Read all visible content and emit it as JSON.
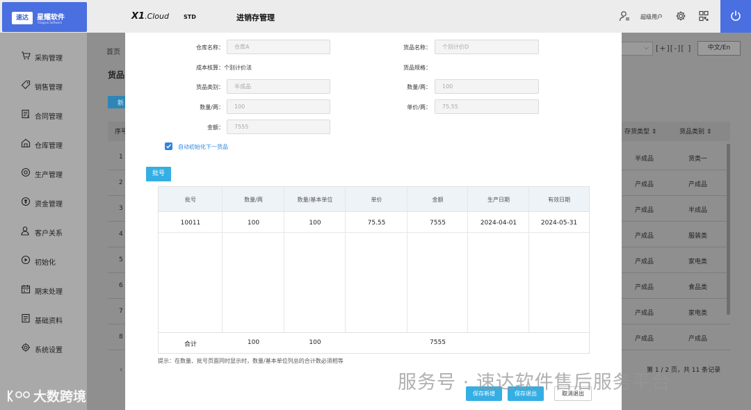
{
  "header": {
    "logo_badge": "速达",
    "logo_name": "星耀软件",
    "logo_sub": "Xingyao Software",
    "brand_main": "X1",
    "brand_suffix": ".Cloud",
    "edition": "STD",
    "module_title": "进销存管理",
    "user_label": "超级用户"
  },
  "sidebar": {
    "items": [
      {
        "label": "采购管理",
        "icon": "cart-icon"
      },
      {
        "label": "销售管理",
        "icon": "tag-icon"
      },
      {
        "label": "合同管理",
        "icon": "contract-icon"
      },
      {
        "label": "仓库管理",
        "icon": "warehouse-icon"
      },
      {
        "label": "生产管理",
        "icon": "production-icon"
      },
      {
        "label": "资金管理",
        "icon": "money-icon"
      },
      {
        "label": "客户关系",
        "icon": "customer-icon"
      },
      {
        "label": "初始化",
        "icon": "init-icon"
      },
      {
        "label": "期末处理",
        "icon": "calendar-icon"
      },
      {
        "label": "基础资料",
        "icon": "document-icon"
      },
      {
        "label": "系统设置",
        "icon": "settings-icon"
      }
    ]
  },
  "background_page": {
    "breadcrumb": "首页",
    "title": "货品",
    "new_button": "新",
    "language_button": "中文/En",
    "seq_header": "序号",
    "col_stock_type": "存货类型",
    "col_goods_category": "货品类别",
    "rows": [
      {
        "no": "1",
        "stock_type": "半成品",
        "category": "货类一"
      },
      {
        "no": "2",
        "stock_type": "产成品",
        "category": "产成品"
      },
      {
        "no": "3",
        "stock_type": "产成品",
        "category": "半成品"
      },
      {
        "no": "4",
        "stock_type": "产成品",
        "category": "服装类"
      },
      {
        "no": "5",
        "stock_type": "产成品",
        "category": "家电类"
      },
      {
        "no": "6",
        "stock_type": "产成品",
        "category": "食品类"
      },
      {
        "no": "7",
        "stock_type": "产成品",
        "category": "家电类"
      },
      {
        "no": "8",
        "stock_type": "产成品",
        "category": "产成品"
      }
    ],
    "pager": "第 1 / 2 页，共 11 条记录"
  },
  "modal": {
    "form": {
      "warehouse_label": "仓库名称：",
      "warehouse_value": "仓库A",
      "goods_name_label": "货品名称：",
      "goods_name_value": "个别计价D",
      "cost_method_label": "成本核算：",
      "cost_method_value": "个别计价法",
      "spec_label": "货品规格：",
      "goods_category_label": "货品类别：",
      "goods_category_value": "半成品",
      "qty_label_right": "数量/两：",
      "qty_value_right": "100",
      "qty_label_left": "数量/两：",
      "qty_value_left": "100",
      "price_label": "单价/两：",
      "price_value": "75.55",
      "amount_label": "金额：",
      "amount_value": "7555",
      "auto_init_label": "自动初始化下一货品",
      "auto_init_checked": true
    },
    "batch_tag": "批号",
    "grid": {
      "headers": [
        "批号",
        "数量/两",
        "数量/基本单位",
        "单价",
        "金额",
        "生产日期",
        "有效日期"
      ],
      "rows": [
        [
          "10011",
          "100",
          "100",
          "75.55",
          "7555",
          "2024-04-01",
          "2024-05-31"
        ]
      ],
      "footer": [
        "合计",
        "100",
        "100",
        "",
        "7555",
        "",
        ""
      ]
    },
    "hint": "提示：在数量、批号页面同时显示时，数量/基本单位列总的合计数必须相等",
    "buttons": {
      "save_new": "保存新增",
      "save_exit": "保存退出",
      "cancel_exit": "取消退出"
    }
  },
  "watermarks": {
    "right": "服务号 · 速达软件售后服务平台",
    "left": "大数跨境"
  }
}
